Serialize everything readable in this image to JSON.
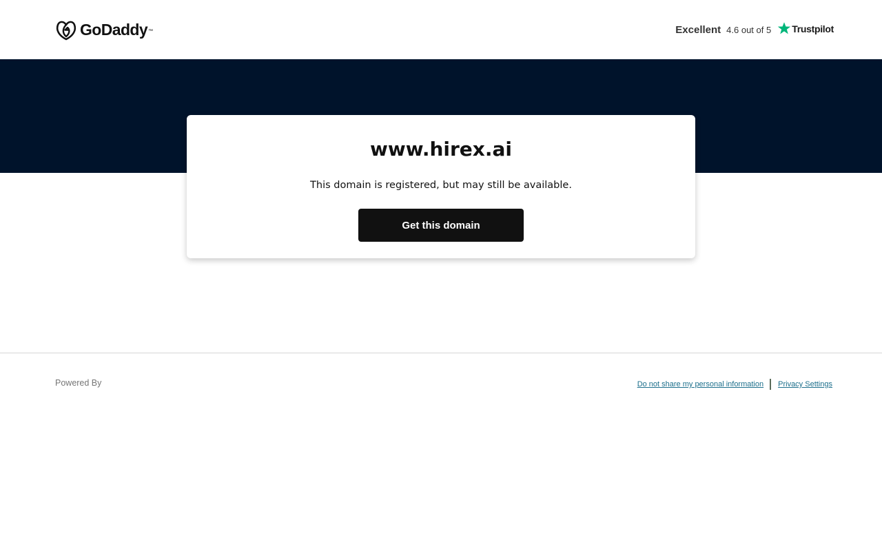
{
  "header": {
    "logo_text": "GoDaddy",
    "logo_tm": "™",
    "trustpilot": {
      "rating_word": "Excellent",
      "score_text": "4.6 out of 5",
      "brand": "Trustpilot",
      "star_color": "#00b67a"
    }
  },
  "colors": {
    "hero_background": "#00132b",
    "button_background": "#111111",
    "link": "#1b6e8b"
  },
  "card": {
    "domain": "www.hirex.ai",
    "message": "This domain is registered, but may still be available.",
    "button_label": "Get this domain"
  },
  "footer": {
    "powered_by": "Powered By",
    "links": [
      {
        "label": "Do not share my personal information"
      },
      {
        "label": "Privacy Settings"
      }
    ]
  }
}
